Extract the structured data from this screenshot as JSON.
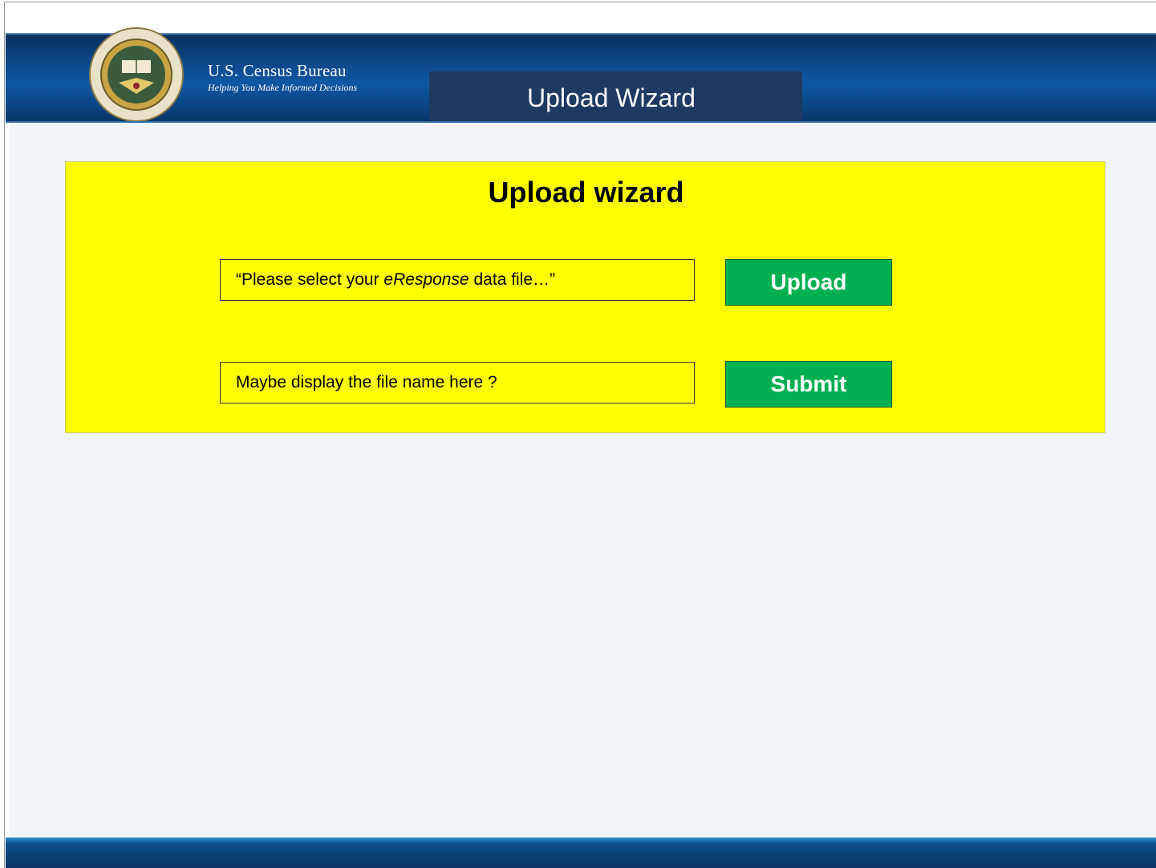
{
  "header": {
    "brand_title": "U.S. Census Bureau",
    "brand_tagline": "Helping You Make Informed Decisions",
    "tab_title": "Upload Wizard",
    "seal_icon": "department-of-commerce-seal"
  },
  "wizard": {
    "title": "Upload wizard",
    "file_prompt_prefix": "“Please select your ",
    "file_prompt_italic": "eResponse",
    "file_prompt_suffix": " data file…”",
    "file_name_text": "Maybe display the file name here ?",
    "upload_label": "Upload",
    "submit_label": "Submit"
  },
  "colors": {
    "header_blue": "#0d57a3",
    "tab_navy": "#1d3a63",
    "panel_yellow": "#ffff00",
    "button_green": "#00b050",
    "content_bg": "#f1f4f8"
  }
}
